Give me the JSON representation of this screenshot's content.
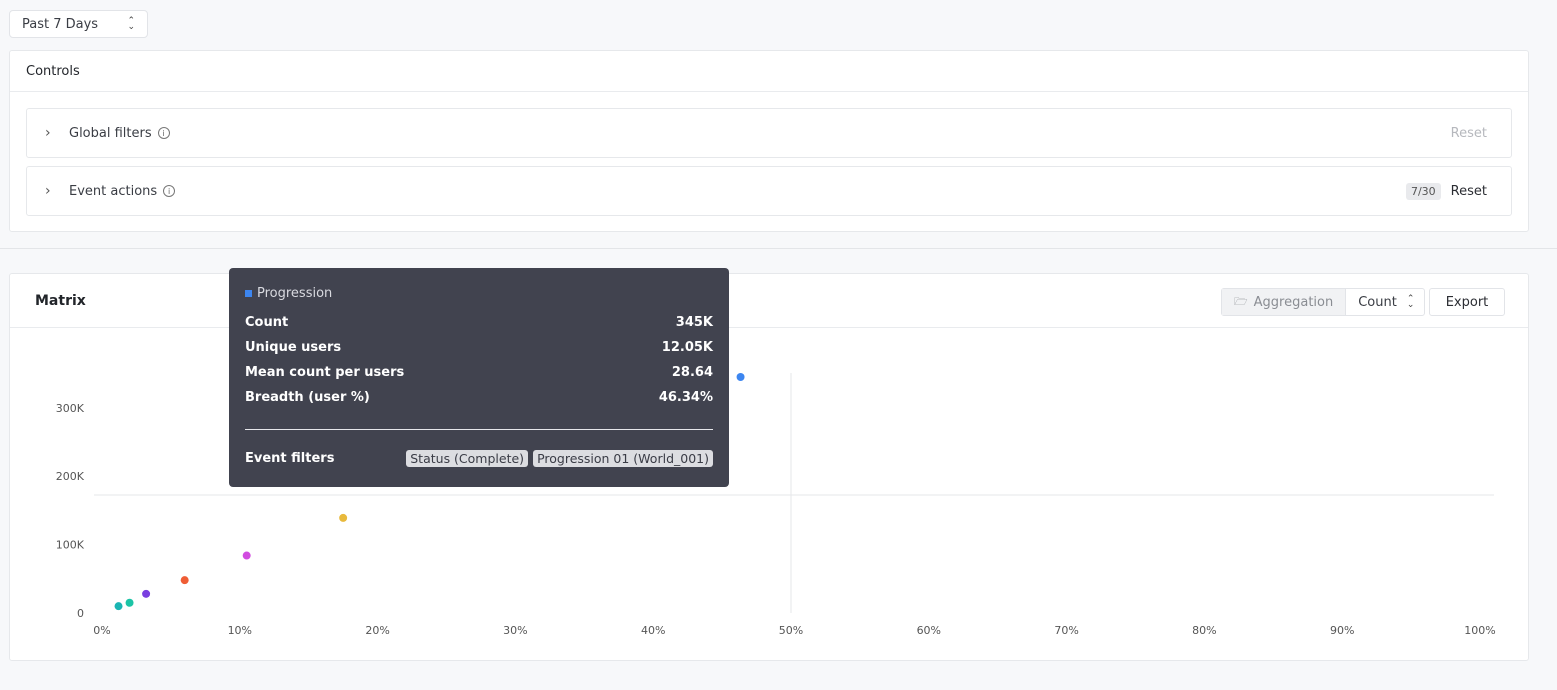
{
  "date_range": {
    "value": "Past 7 Days"
  },
  "controls": {
    "title": "Controls",
    "global_filters": {
      "label": "Global filters",
      "reset": "Reset"
    },
    "event_actions": {
      "label": "Event actions",
      "badge": "7/30",
      "reset": "Reset"
    }
  },
  "matrix": {
    "title": "Matrix",
    "aggregation_label": "Aggregation",
    "aggregation_value": "Count",
    "export_label": "Export"
  },
  "tooltip": {
    "title": "Progression",
    "swatch_color": "#3d86f0",
    "rows": [
      {
        "label": "Count",
        "value": "345K"
      },
      {
        "label": "Unique users",
        "value": "12.05K"
      },
      {
        "label": "Mean count per users",
        "value": "28.64"
      },
      {
        "label": "Breadth (user %)",
        "value": "46.34%"
      }
    ],
    "filters_label": "Event filters",
    "filter_tags": [
      "Status  (Complete)",
      "Progression 01  (World_001)"
    ]
  },
  "chart_data": {
    "type": "scatter",
    "x_ticks": [
      "0%",
      "10%",
      "20%",
      "30%",
      "40%",
      "50%",
      "60%",
      "70%",
      "80%",
      "90%",
      "100%"
    ],
    "y_ticks": [
      "0",
      "100K",
      "200K",
      "300K"
    ],
    "xlim": [
      0,
      100
    ],
    "ylim": [
      0,
      345000
    ],
    "reference_lines": {
      "x": 50,
      "y": 172500
    },
    "points": [
      {
        "x": 46.34,
        "y": 345000,
        "color": "#3d86f0"
      },
      {
        "x": 17.5,
        "y": 139000,
        "color": "#e8b93c"
      },
      {
        "x": 10.5,
        "y": 84000,
        "color": "#d14ce0"
      },
      {
        "x": 6.0,
        "y": 48000,
        "color": "#ef5d35"
      },
      {
        "x": 3.2,
        "y": 28000,
        "color": "#7a3fe0"
      },
      {
        "x": 2.0,
        "y": 15000,
        "color": "#1cc4a6"
      },
      {
        "x": 1.2,
        "y": 10000,
        "color": "#1bb5b3"
      }
    ]
  }
}
